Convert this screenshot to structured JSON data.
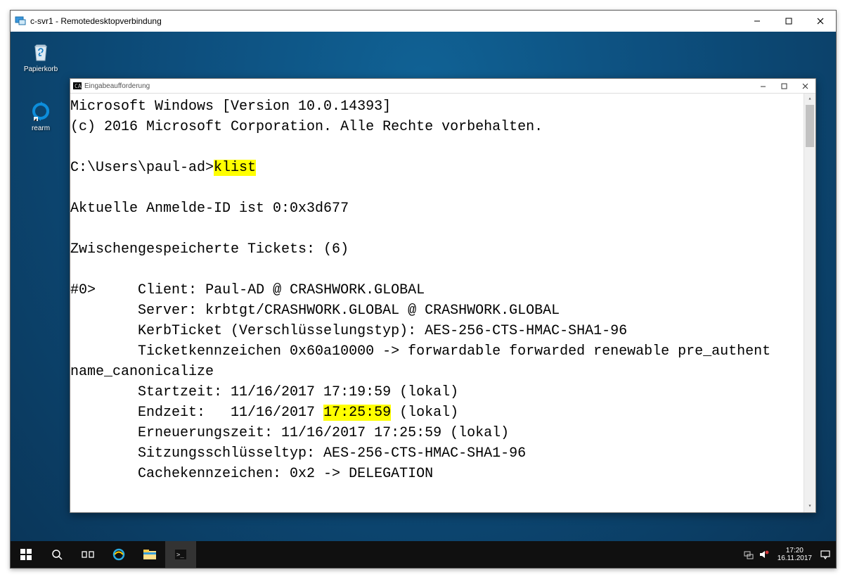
{
  "rdp": {
    "title": "c-svr1 - Remotedesktopverbindung"
  },
  "desktop_icons": {
    "recycle_bin": "Papierkorb",
    "rearm": "rearm"
  },
  "cmd": {
    "title": "Eingabeaufforderung",
    "banner_line1": "Microsoft Windows [Version 10.0.14393]",
    "banner_line2": "(c) 2016 Microsoft Corporation. Alle Rechte vorbehalten.",
    "prompt": "C:\\Users\\paul-ad>",
    "command": "klist",
    "login_id_line": "Aktuelle Anmelde-ID ist 0:0x3d677",
    "cached_tickets_line": "Zwischengespeicherte Tickets: (6)",
    "ticket0_header": "#0>",
    "ticket0_client_label": "Client:",
    "ticket0_client_value": "Paul-AD @ CRASHWORK.GLOBAL",
    "ticket0_server_label": "Server:",
    "ticket0_server_value": "krbtgt/CRASHWORK.GLOBAL @ CRASHWORK.GLOBAL",
    "ticket0_kerbticket": "KerbTicket (Verschlüsselungstyp): AES-256-CTS-HMAC-SHA1-96",
    "ticket0_flags": "Ticketkennzeichen 0x60a10000 -> forwardable forwarded renewable pre_authent name_canonicalize",
    "ticket0_start": "Startzeit: 11/16/2017 17:19:59 (lokal)",
    "ticket0_end_prefix": "Endzeit:   11/16/2017 ",
    "ticket0_end_highlight": "17:25:59",
    "ticket0_end_suffix": " (lokal)",
    "ticket0_renew": "Erneuerungszeit: 11/16/2017 17:25:59 (lokal)",
    "ticket0_sessionkey": "Sitzungsschlüsseltyp: AES-256-CTS-HMAC-SHA1-96",
    "ticket0_cacheflags": "Cachekennzeichen: 0x2 -> DELEGATION"
  },
  "taskbar": {
    "time": "17:20",
    "date": "16.11.2017"
  }
}
